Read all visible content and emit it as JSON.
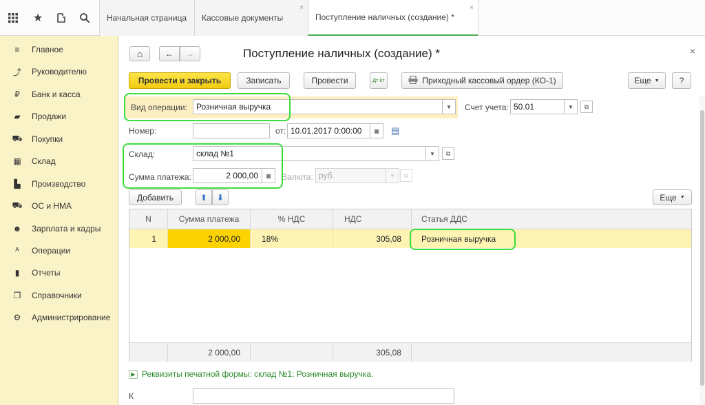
{
  "topbar": {
    "icons": [
      "apps-grid-icon",
      "star-icon",
      "history-icon",
      "search-icon"
    ],
    "tabs": [
      {
        "label": "Начальная страница"
      },
      {
        "label": "Кассовые документы"
      },
      {
        "label": "Поступление наличных (создание) *"
      }
    ],
    "close_glyph": "×"
  },
  "sidebar": {
    "items": [
      {
        "label": "Главное",
        "icon": "≡"
      },
      {
        "label": "Руководителю",
        "icon": "⤴"
      },
      {
        "label": "Банк и касса",
        "icon": "₽"
      },
      {
        "label": "Продажи",
        "icon": "▰"
      },
      {
        "label": "Покупки",
        "icon": "⛟"
      },
      {
        "label": "Склад",
        "icon": "▦"
      },
      {
        "label": "Производство",
        "icon": "▙"
      },
      {
        "label": "ОС и НМА",
        "icon": "⛟"
      },
      {
        "label": "Зарплата и кадры",
        "icon": "☻"
      },
      {
        "label": "Операции",
        "icon": "ᴬ"
      },
      {
        "label": "Отчеты",
        "icon": "▮"
      },
      {
        "label": "Справочники",
        "icon": "❐"
      },
      {
        "label": "Администрирование",
        "icon": "⚙"
      }
    ]
  },
  "form": {
    "title": "Поступление наличных (создание) *",
    "nav": {
      "home": "⌂",
      "back": "←",
      "forward": "→"
    },
    "toolbar": {
      "post_close": "Провести и закрыть",
      "save": "Записать",
      "post": "Провести",
      "dtkt": "Дт Кт",
      "print_order": "Приходный кассовый ордер (КО-1)",
      "more": "Еще",
      "help": "?"
    },
    "operation": {
      "label": "Вид операции:",
      "value": "Розничная выручка"
    },
    "account": {
      "label": "Счет учета:",
      "value": "50.01"
    },
    "number": {
      "label": "Номер:",
      "value": ""
    },
    "date": {
      "label": "от:",
      "value": "10.01.2017  0:00:00"
    },
    "warehouse": {
      "label": "Склад:",
      "value": "склад №1"
    },
    "amount": {
      "label": "Сумма платежа:",
      "value": "2 000,00"
    },
    "currency": {
      "label": "Валюта:",
      "value": "руб."
    },
    "table_toolbar": {
      "add": "Добавить",
      "more": "Еще"
    },
    "table": {
      "columns": [
        "N",
        "Сумма платежа",
        "% НДС",
        "НДС",
        "Статья ДДС"
      ],
      "rows": [
        {
          "n": "1",
          "amount": "2 000,00",
          "vat_rate": "18%",
          "vat": "305,08",
          "dds": "Розничная выручка"
        }
      ],
      "totals": {
        "amount": "2 000,00",
        "vat": "305,08"
      }
    },
    "print_details": "Реквизиты печатной формы: склад №1; Розничная выручка.",
    "comment_label": "К"
  }
}
